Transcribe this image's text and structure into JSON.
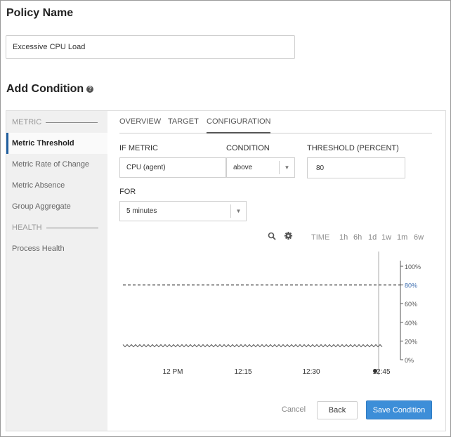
{
  "policy": {
    "title": "Policy Name",
    "value": "Excessive CPU Load"
  },
  "condition": {
    "title": "Add Condition",
    "help_icon": "help-circle-icon"
  },
  "sidebar": {
    "metric_header": "METRIC",
    "health_header": "HEALTH",
    "items": [
      {
        "label": "Metric Threshold",
        "active": true
      },
      {
        "label": "Metric Rate of Change"
      },
      {
        "label": "Metric Absence"
      },
      {
        "label": "Group Aggregate"
      }
    ],
    "health_items": [
      {
        "label": "Process Health"
      }
    ]
  },
  "tabs": [
    {
      "label": "OVERVIEW"
    },
    {
      "label": "TARGET"
    },
    {
      "label": "CONFIGURATION",
      "active": true
    }
  ],
  "form": {
    "if_metric_label": "IF METRIC",
    "if_metric_value": "CPU (agent)",
    "condition_label": "CONDITION",
    "condition_value": "above",
    "threshold_label": "THRESHOLD (PERCENT)",
    "threshold_value": "80",
    "for_label": "FOR",
    "for_value": "5 minutes"
  },
  "chart_toolbar": {
    "zoom_icon": "zoom-icon",
    "settings_icon": "gear-icon",
    "time_label": "TIME",
    "ranges": [
      "1h",
      "6h",
      "1d",
      "1w",
      "1m",
      "6w"
    ]
  },
  "chart_data": {
    "type": "line",
    "title": "",
    "x_ticks": [
      "12 PM",
      "12:15",
      "12:30",
      "12:45"
    ],
    "y_ticks": [
      "100%",
      "80%",
      "60%",
      "40%",
      "20%",
      "0%"
    ],
    "ylim": [
      0,
      100
    ],
    "threshold": 80,
    "series": [
      {
        "approx_level": 15
      }
    ],
    "colors": {
      "threshold_label": "#3f6fb0",
      "line": "#555555"
    }
  },
  "actions": {
    "cancel": "Cancel",
    "back": "Back",
    "save": "Save Condition"
  }
}
